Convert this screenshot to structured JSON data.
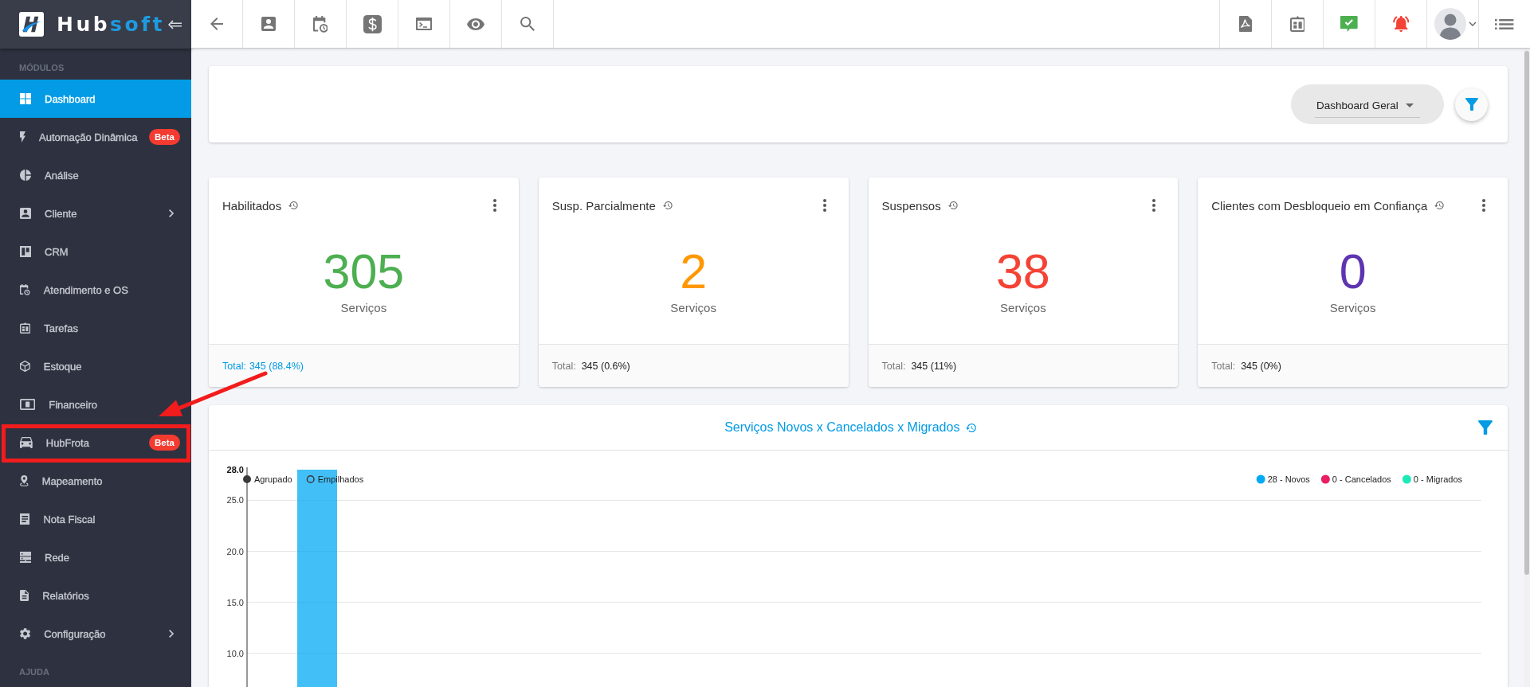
{
  "logo": {
    "parts": [
      "Hub",
      "soft"
    ]
  },
  "sidebar": {
    "sections": [
      {
        "title": "MÓDULOS",
        "items": [
          {
            "label": "Dashboard",
            "selected": true,
            "highlighted": false,
            "submenu": false
          },
          {
            "label": "Automação Dinâmica",
            "badge": "Beta",
            "selected": false,
            "highlighted": false,
            "submenu": false
          },
          {
            "label": "Análise",
            "selected": false,
            "highlighted": false,
            "submenu": false
          },
          {
            "label": "Cliente",
            "selected": false,
            "highlighted": false,
            "submenu": true
          },
          {
            "label": "CRM",
            "selected": false,
            "highlighted": false,
            "submenu": false
          },
          {
            "label": "Atendimento e OS",
            "selected": false,
            "highlighted": false,
            "submenu": false
          },
          {
            "label": "Tarefas",
            "selected": false,
            "highlighted": false,
            "submenu": false
          },
          {
            "label": "Estoque",
            "selected": false,
            "highlighted": false,
            "submenu": false
          },
          {
            "label": "Financeiro",
            "selected": false,
            "highlighted": false,
            "submenu": false
          },
          {
            "label": "HubFrota",
            "badge": "Beta",
            "selected": false,
            "highlighted": true,
            "submenu": false
          },
          {
            "label": "Mapeamento",
            "selected": false,
            "highlighted": false,
            "submenu": false
          },
          {
            "label": "Nota Fiscal",
            "selected": false,
            "highlighted": false,
            "submenu": false
          },
          {
            "label": "Rede",
            "selected": false,
            "highlighted": false,
            "submenu": false
          },
          {
            "label": "Relatórios",
            "selected": false,
            "highlighted": false,
            "submenu": false
          },
          {
            "label": "Configuração",
            "selected": false,
            "highlighted": false,
            "submenu": true
          }
        ]
      },
      {
        "title": "AJUDA"
      }
    ]
  },
  "dashboard_select": {
    "value": "Dashboard Geral"
  },
  "cards": [
    {
      "title": "Habilitados",
      "value": "305",
      "unit": "Serviços",
      "total_label": "Total:",
      "total_value": "345 (88.4%)",
      "color": "#4caf50",
      "hover": true
    },
    {
      "title": "Susp. Parcialmente",
      "value": "2",
      "unit": "Serviços",
      "total_label": "Total:",
      "total_value": "345 (0.6%)",
      "color": "#ff9800",
      "hover": false
    },
    {
      "title": "Suspensos",
      "value": "38",
      "unit": "Serviços",
      "total_label": "Total:",
      "total_value": "345 (11%)",
      "color": "#f44336",
      "hover": false
    },
    {
      "title": "Clientes com Desbloqueio em Confiança",
      "value": "0",
      "unit": "Serviços",
      "total_label": "Total:",
      "total_value": "345 (0%)",
      "color": "#5e35b1",
      "hover": false
    }
  ],
  "chart_panel": {
    "title": "Serviços Novos x Cancelados x Migrados",
    "modes": [
      {
        "label": "Agrupado",
        "selected": true
      },
      {
        "label": "Empilhados",
        "selected": false
      }
    ],
    "chart_data": {
      "type": "bar",
      "ylim": [
        6.7,
        28
      ],
      "grid": true,
      "yticks": [
        {
          "value": 10,
          "label": "10.0"
        },
        {
          "value": 15,
          "label": "15.0"
        },
        {
          "value": 20,
          "label": "20.0"
        },
        {
          "value": 25,
          "label": "25.0"
        },
        {
          "value": 28,
          "label": "28.0"
        }
      ],
      "series": [
        {
          "name": "28 - Novos",
          "color": "#03a9f4",
          "values": [
            28
          ]
        },
        {
          "name": "0 - Cancelados",
          "color": "#e91e63",
          "values": [
            null
          ]
        },
        {
          "name": "0 - Migrados",
          "color": "#1de9b6",
          "values": [
            null
          ]
        }
      ]
    }
  }
}
